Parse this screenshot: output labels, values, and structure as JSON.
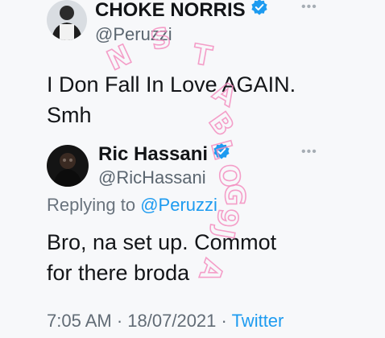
{
  "tweet": {
    "author_name": "CHOKE NORRIS",
    "author_handle": "@Peruzzi",
    "text_line1": "I Don Fall In Love AGAIN.",
    "text_line2": "Smh",
    "more_icon": "more-dots-icon",
    "verified_icon": "verified-badge-icon"
  },
  "reply": {
    "author_name": "Ric Hassani",
    "author_handle": "@RicHassani",
    "replying_prefix": "Replying to",
    "replying_mention": "@Peruzzi",
    "text_line1": "Bro, na set up. Commot",
    "text_line2": "for there broda",
    "more_icon": "more-dots-icon",
    "verified_icon": "verified-badge-icon"
  },
  "footer": {
    "time": "7:05 AM",
    "separator1": "·",
    "date": "18/07/2021",
    "separator2": "·",
    "source": "Twitter"
  },
  "watermark": {
    "letters": [
      "N",
      "S",
      "T",
      "A",
      "B",
      "L",
      "O",
      "G",
      "9",
      "J",
      "A"
    ]
  },
  "colors": {
    "accent": "#1d9bf0",
    "watermark": "#f48fc0",
    "background": "#f7f8fa"
  }
}
